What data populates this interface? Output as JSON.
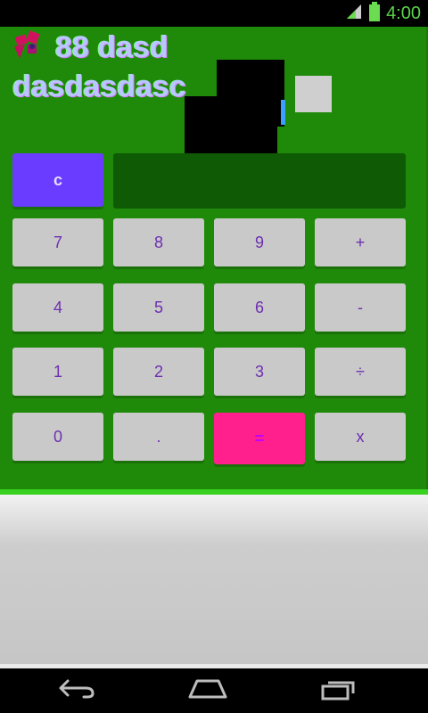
{
  "status_bar": {
    "time": "4:00",
    "signal_icon": "signal-icon",
    "battery_icon": "battery-icon"
  },
  "header": {
    "logo_icon": "flower-logo-icon",
    "title": "88 dasd",
    "subtitle": "dasdasdasc"
  },
  "calculator": {
    "clear_label": "c",
    "display_value": "",
    "rows": [
      [
        "7",
        "8",
        "9",
        "+"
      ],
      [
        "4",
        "5",
        "6",
        "-"
      ],
      [
        "1",
        "2",
        "3",
        "÷"
      ],
      [
        "0",
        ".",
        "=",
        "x"
      ]
    ]
  },
  "navigation": {
    "back_icon": "back-icon",
    "home_icon": "home-icon",
    "recents_icon": "recents-icon"
  },
  "colors": {
    "app_background": "#1f8a0a",
    "display_background": "#0f5a05",
    "clear_button": "#6a3cff",
    "equals_button": "#ff1f8d",
    "key_background": "#c9c9c9"
  }
}
